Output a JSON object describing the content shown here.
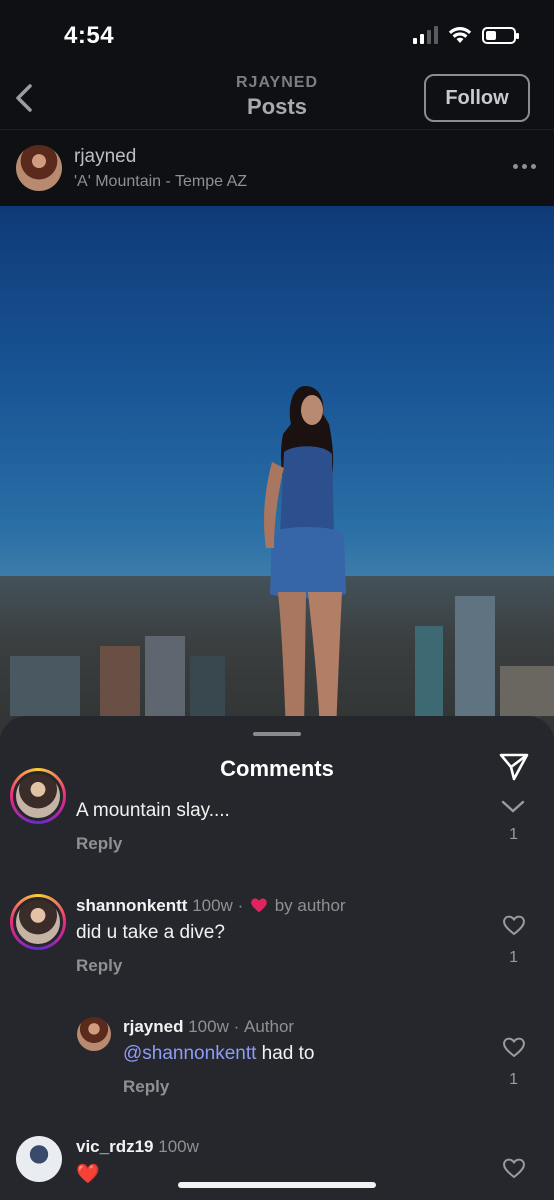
{
  "status_bar": {
    "time": "4:54"
  },
  "nav": {
    "subtitle": "RJAYNED",
    "title": "Posts",
    "follow_label": "Follow"
  },
  "post": {
    "username": "rjayned",
    "location": "'A' Mountain - Tempe AZ"
  },
  "comments_sheet": {
    "title": "Comments",
    "comments": [
      {
        "text": "A mountain slay....",
        "reply_label": "Reply",
        "like_count": "1"
      },
      {
        "username": "shannonkentt",
        "time": "100w",
        "separator": "·",
        "liked_by": "by author",
        "text": "did u take a dive?",
        "reply_label": "Reply",
        "like_count": "1"
      },
      {
        "username": "rjayned",
        "time": "100w",
        "separator": "·",
        "role": "Author",
        "mention": "@shannonkentt",
        "text": " had to",
        "reply_label": "Reply",
        "like_count": "1"
      },
      {
        "username": "vic_rdz19",
        "time": "100w",
        "text": "❤️"
      }
    ]
  },
  "colors": {
    "mention": "#8d9cf7",
    "sheet_bg": "#25272c",
    "heart_red": "#e0245e"
  }
}
